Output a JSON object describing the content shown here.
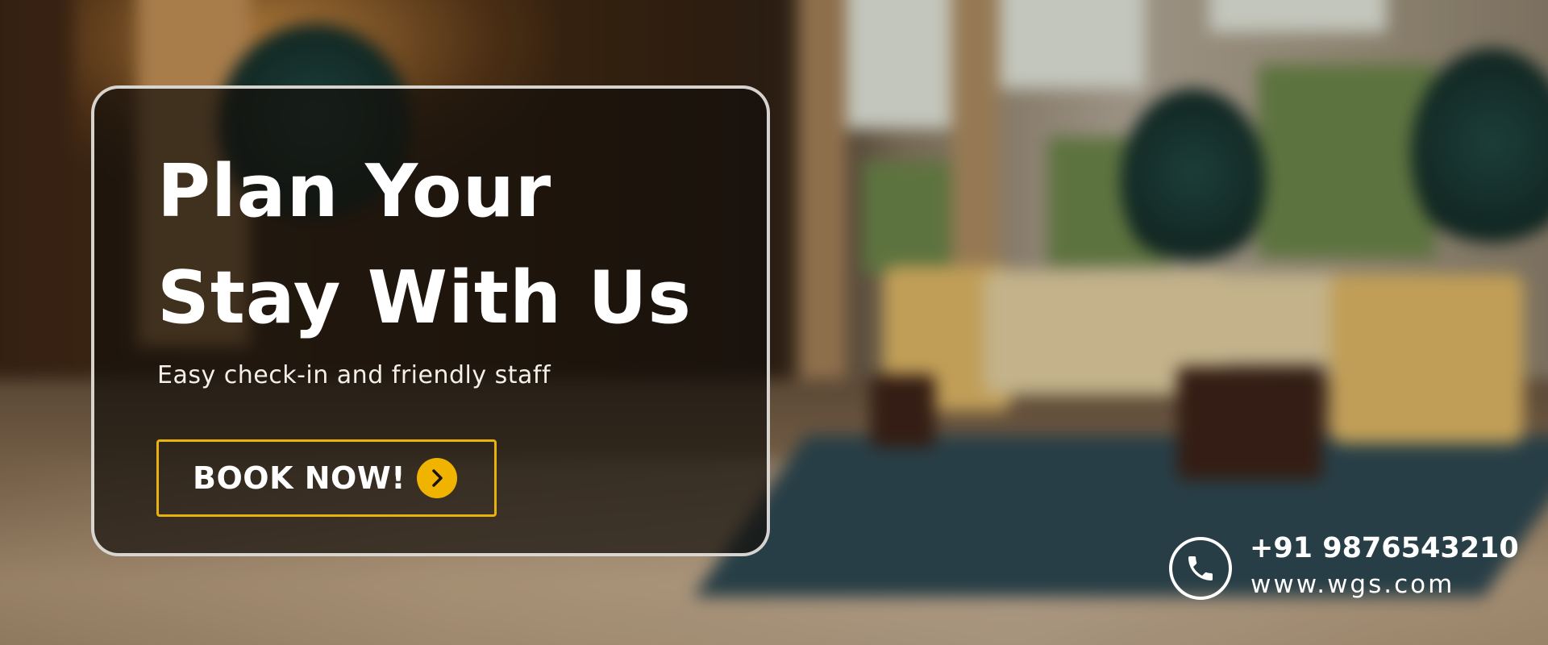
{
  "banner": {
    "headline_line1": "Plan Your",
    "headline_line2": "Stay With Us",
    "subtitle": "Easy check-in and friendly staff",
    "cta_label": "BOOK NOW!"
  },
  "contact": {
    "phone": "+91 9876543210",
    "website": "www.wgs.com"
  },
  "icons": {
    "cta_arrow": "chevron-right-icon",
    "contact_phone": "phone-icon"
  },
  "colors": {
    "accent": "#f0b400",
    "button_border": "#e8b10c",
    "text": "#ffffff",
    "card_border": "#ebe8e4"
  }
}
